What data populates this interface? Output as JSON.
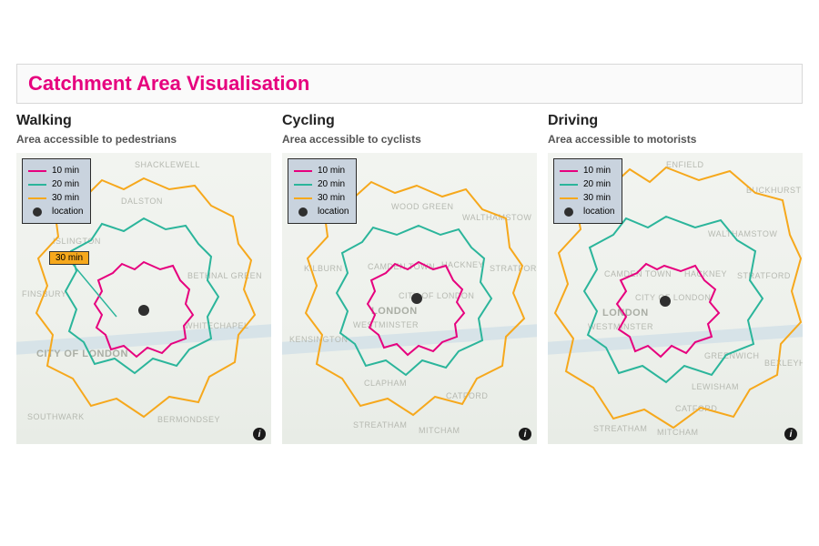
{
  "title": "Catchment Area Visualisation",
  "colors": {
    "pink": "#e6007e",
    "teal": "#2bb59b",
    "orange": "#f6a81c",
    "dark": "#2f2f2f"
  },
  "legend": {
    "ten": "10 min",
    "twenty": "20 min",
    "thirty": "30 min",
    "loc": "location"
  },
  "panels": [
    {
      "title": "Walking",
      "subtitle": "Area accessible to pedestrians",
      "tooltip": "30 min",
      "center_label": "CITY OF LONDON",
      "map_labels": [
        "SHACKLEWELL",
        "DALSTON",
        "Islington",
        "BETHNAL GREEN",
        "WHITECHAPEL",
        "FINSBURY",
        "SOUTHWARK",
        "BERMONDSEY"
      ]
    },
    {
      "title": "Cycling",
      "subtitle": "Area accessible to cyclists",
      "center_label": "LONDON",
      "map_labels": [
        "Wood Green",
        "Walthamstow",
        "Kilburn",
        "Camden Town",
        "Hackney",
        "Stratford",
        "WESTMINSTER",
        "Kensington",
        "Clapham",
        "Catford",
        "Streatham",
        "Mitcham",
        "CITY OF LONDON"
      ]
    },
    {
      "title": "Driving",
      "subtitle": "Area accessible to motorists",
      "center_label": "LONDON",
      "map_labels": [
        "Enfield",
        "Buckhurst Hill",
        "Walthamstow",
        "Camden Town",
        "Hackney",
        "Stratford",
        "WESTMINSTER",
        "Greenwich",
        "Bexleyh",
        "Lewisham",
        "Catford",
        "Streatham",
        "Mitcham",
        "CITY OF LONDON"
      ]
    }
  ]
}
